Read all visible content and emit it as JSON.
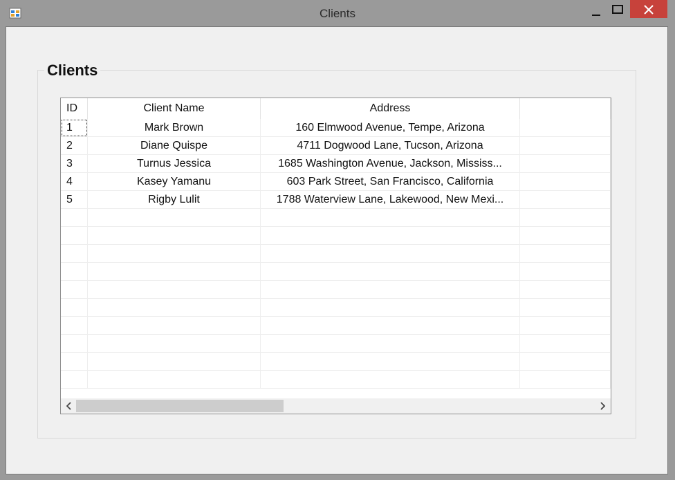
{
  "window": {
    "title": "Clients"
  },
  "group": {
    "label": "Clients"
  },
  "grid": {
    "columns": [
      "ID",
      "Client Name",
      "Address",
      ""
    ],
    "rows": [
      {
        "id": "1",
        "name": "Mark Brown",
        "address": "160 Elmwood Avenue, Tempe, Arizona"
      },
      {
        "id": "2",
        "name": "Diane Quispe",
        "address": "4711 Dogwood Lane, Tucson, Arizona"
      },
      {
        "id": "3",
        "name": "Turnus Jessica",
        "address": "1685 Washington Avenue, Jackson, Mississ..."
      },
      {
        "id": "4",
        "name": "Kasey Yamanu",
        "address": "603 Park Street, San Francisco, California"
      },
      {
        "id": "5",
        "name": "Rigby Lulit",
        "address": "1788 Waterview Lane, Lakewood, New Mexi..."
      }
    ],
    "empty_rows": 10
  },
  "colors": {
    "titlebar": "#9a9a9a",
    "close_button": "#c7423b",
    "client_background": "#f0f0f0"
  }
}
